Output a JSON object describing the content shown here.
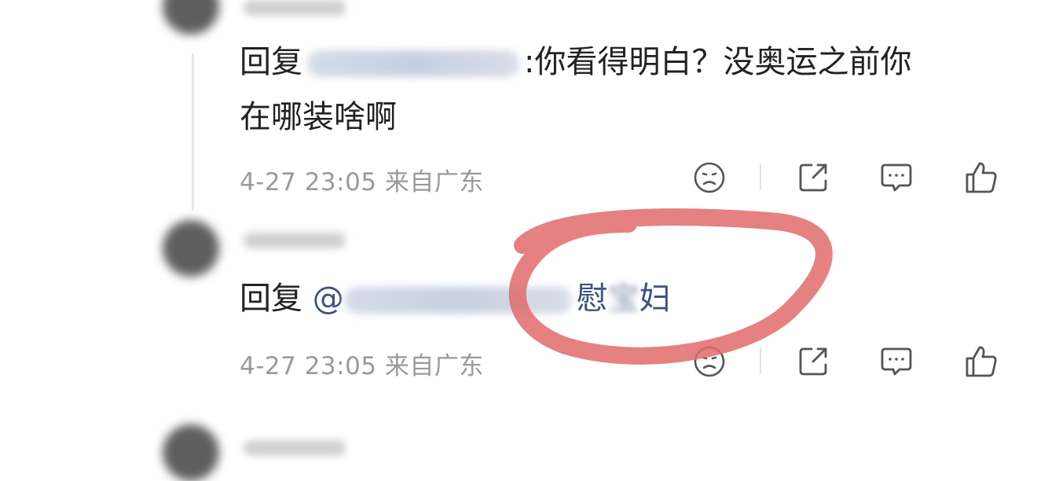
{
  "comments": [
    {
      "reply_prefix": "回复",
      "text_line1": ":你看得明白？没奥运之前你",
      "text_line2": "在哪装啥啊",
      "time": "4-27 23:05",
      "location": "来自广东"
    },
    {
      "reply_prefix": "回复",
      "mention_at": "@",
      "mention_tail_1": "慰",
      "mention_tail_2": "妇",
      "time": "4-27 23:05",
      "location": "来自广东"
    }
  ],
  "icons": {
    "react": "sad-face-icon",
    "share": "share-icon",
    "comment": "comment-icon",
    "like": "thumbs-up-icon"
  },
  "colors": {
    "annotation": "#e06b6b",
    "mention": "#3d5283",
    "meta": "#9a9a9a"
  }
}
